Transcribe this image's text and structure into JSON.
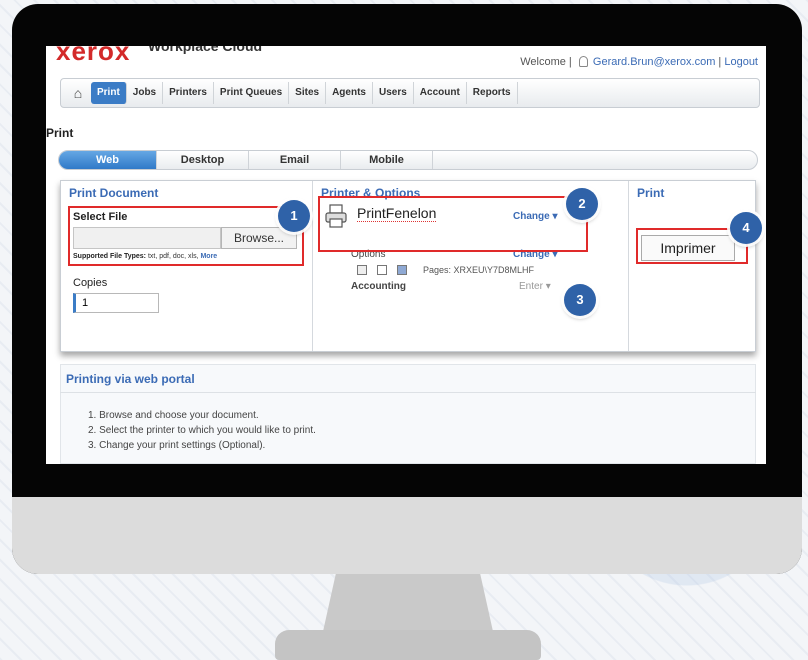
{
  "header": {
    "logo": "xerox",
    "product": "Workplace Cloud",
    "welcome": "Welcome |",
    "user": "Gerard.Brun@xerox.com",
    "separator": "|",
    "logout": "Logout"
  },
  "nav": {
    "home_icon": "home-icon",
    "items": [
      "Print",
      "Jobs",
      "Printers",
      "Print Queues",
      "Sites",
      "Agents",
      "Users",
      "Account",
      "Reports"
    ]
  },
  "page_title": "Print",
  "tabs": [
    "Web",
    "Desktop",
    "Email",
    "Mobile"
  ],
  "print_document": {
    "title": "Print Document",
    "select_file_label": "Select File",
    "browse_label": "Browse...",
    "supported_prefix": "Supported File Types:",
    "supported_types": " txt, pdf, doc, xls, ",
    "more": "More",
    "copies_label": "Copies",
    "copies_value": "1"
  },
  "printer_options": {
    "title": "Printer & Options",
    "printer_name": "PrintFenelon",
    "change_label": "Change",
    "options_label": "Options",
    "options_change": "Change",
    "pages": "Pages: XRXEU\\Y7D8MLHF",
    "accounting_label": "Accounting",
    "enter_label": "Enter"
  },
  "print_col": {
    "title": "Print",
    "imprimer": "Imprimer"
  },
  "badges": [
    "1",
    "2",
    "3",
    "4"
  ],
  "portal": {
    "title": "Printing via web portal",
    "steps": [
      "1.  Browse and choose your document.",
      "2.  Select the printer to which you would like to print.",
      "3.  Change your print settings (Optional)."
    ]
  },
  "colors": {
    "accent": "#3b7cc6",
    "link": "#3b6bb5",
    "highlight": "#e02a2a",
    "badge": "#2f62a8",
    "logo": "#d32a2a"
  }
}
